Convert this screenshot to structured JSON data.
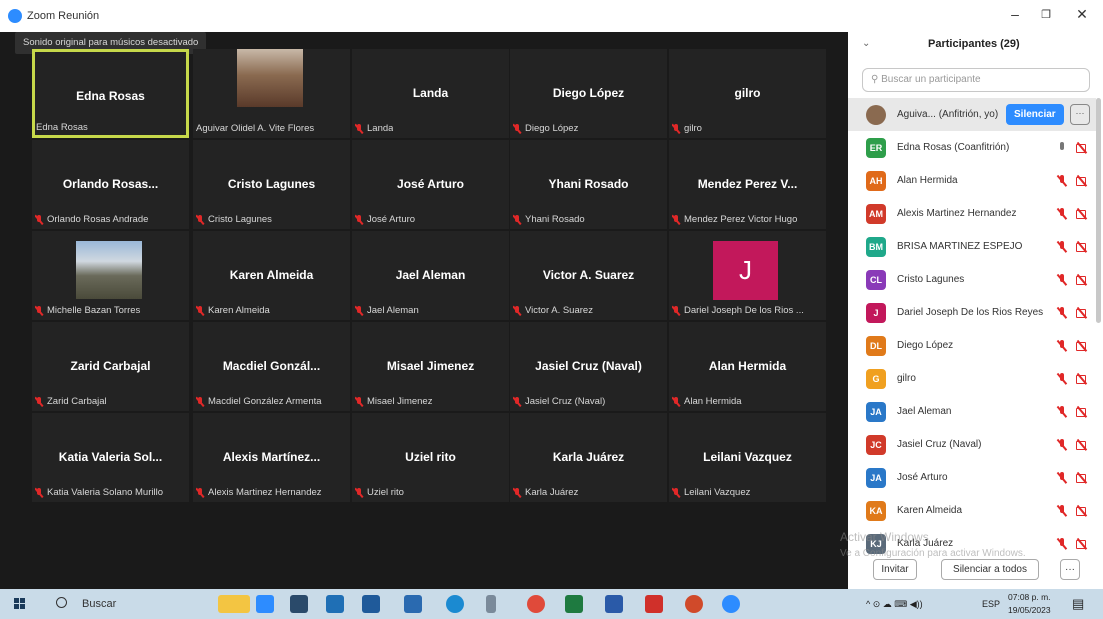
{
  "window": {
    "title": "Zoom Reunión"
  },
  "notice": "Sonido original para músicos desactivado",
  "tiles": [
    {
      "name": "Edna Rosas",
      "label": "Edna Rosas",
      "muted": false,
      "active": true
    },
    {
      "name": "",
      "label": "Aguivar Olidel A. Vite Flores",
      "muted": false,
      "video": true
    },
    {
      "name": "Landa",
      "label": "Landa",
      "muted": true
    },
    {
      "name": "Diego López",
      "label": "Diego López",
      "muted": true
    },
    {
      "name": "gilro",
      "label": "gilro",
      "muted": true
    },
    {
      "name": "Orlando Rosas...",
      "label": "Orlando Rosas Andrade",
      "muted": true
    },
    {
      "name": "Cristo Lagunes",
      "label": "Cristo Lagunes",
      "muted": true
    },
    {
      "name": "José Arturo",
      "label": "José Arturo",
      "muted": true
    },
    {
      "name": "Yhani Rosado",
      "label": "Yhani Rosado",
      "muted": true
    },
    {
      "name": "Mendez Perez V...",
      "label": "Mendez Perez Victor Hugo",
      "muted": true
    },
    {
      "name": "",
      "label": "Michelle Bazan Torres",
      "muted": true,
      "photo": true
    },
    {
      "name": "Karen Almeida",
      "label": "Karen Almeida",
      "muted": true
    },
    {
      "name": "Jael Aleman",
      "label": "Jael Aleman",
      "muted": true
    },
    {
      "name": "Victor A. Suarez",
      "label": "Victor A. Suarez",
      "muted": true
    },
    {
      "name": "",
      "label": "Dariel Joseph De los Rios ...",
      "muted": true,
      "initial": "J"
    },
    {
      "name": "Zarid Carbajal",
      "label": "Zarid Carbajal",
      "muted": true
    },
    {
      "name": "Macdiel Gonzál...",
      "label": "Macdiel González Armenta",
      "muted": true
    },
    {
      "name": "Misael Jimenez",
      "label": "Misael Jimenez",
      "muted": true
    },
    {
      "name": "Jasiel Cruz (Naval)",
      "label": "Jasiel Cruz (Naval)",
      "muted": true
    },
    {
      "name": "Alan Hermida",
      "label": "Alan Hermida",
      "muted": true
    },
    {
      "name": "Katia Valeria Sol...",
      "label": "Katia Valeria Solano Murillo",
      "muted": true
    },
    {
      "name": "Alexis Martínez...",
      "label": "Alexis Martinez Hernandez",
      "muted": true
    },
    {
      "name": "Uziel rito",
      "label": "Uziel rito",
      "muted": true
    },
    {
      "name": "Karla Juárez",
      "label": "Karla Juárez",
      "muted": true
    },
    {
      "name": "Leilani Vazquez",
      "label": "Leilani Vazquez",
      "muted": true
    }
  ],
  "panel": {
    "title": "Participantes (29)",
    "search_placeholder": "Buscar un participante",
    "participants": [
      {
        "initials": "",
        "name": "Aguiva... (Anfitrión, yo)",
        "color": "#8a6a50",
        "host": true
      },
      {
        "initials": "ER",
        "name": "Edna Rosas (Coanfitrión)",
        "color": "#2e9e4a",
        "mic_on": true
      },
      {
        "initials": "AH",
        "name": "Alan Hermida",
        "color": "#e06a1a"
      },
      {
        "initials": "AM",
        "name": "Alexis Martinez Hernandez",
        "color": "#d13a2a"
      },
      {
        "initials": "BM",
        "name": "BRISA MARTINEZ ESPEJO",
        "color": "#1fa88a"
      },
      {
        "initials": "CL",
        "name": "Cristo Lagunes",
        "color": "#8a3ab8"
      },
      {
        "initials": "J",
        "name": "Dariel Joseph De los Rios Reyes",
        "color": "#c2185b"
      },
      {
        "initials": "DL",
        "name": "Diego López",
        "color": "#e07a1a"
      },
      {
        "initials": "G",
        "name": "gilro",
        "color": "#f0a020"
      },
      {
        "initials": "JA",
        "name": "Jael Aleman",
        "color": "#2a78c8"
      },
      {
        "initials": "JC",
        "name": "Jasiel Cruz (Naval)",
        "color": "#d13a2a"
      },
      {
        "initials": "JA",
        "name": "José Arturo",
        "color": "#2a78c8"
      },
      {
        "initials": "KA",
        "name": "Karen Almeida",
        "color": "#e07a1a"
      },
      {
        "initials": "KJ",
        "name": "Karla Juárez",
        "color": "#5a6a7a"
      }
    ],
    "silenciar_label": "Silenciar",
    "more_label": "···",
    "invite_label": "Invitar",
    "mute_all_label": "Silenciar a todos",
    "footer_more_label": "···"
  },
  "watermark": {
    "line1": "Activar Windows",
    "line2": "Ve a Configuración para activar Windows."
  },
  "taskbar": {
    "search_label": "Buscar",
    "lang": "ESP",
    "time": "07:08 p. m.",
    "date": "19/05/2023"
  },
  "colors": {
    "zoom_blue": "#2d8cff",
    "active_border": "#c6d84a",
    "tile_bg": "#232323",
    "mute_red": "#e02828"
  }
}
